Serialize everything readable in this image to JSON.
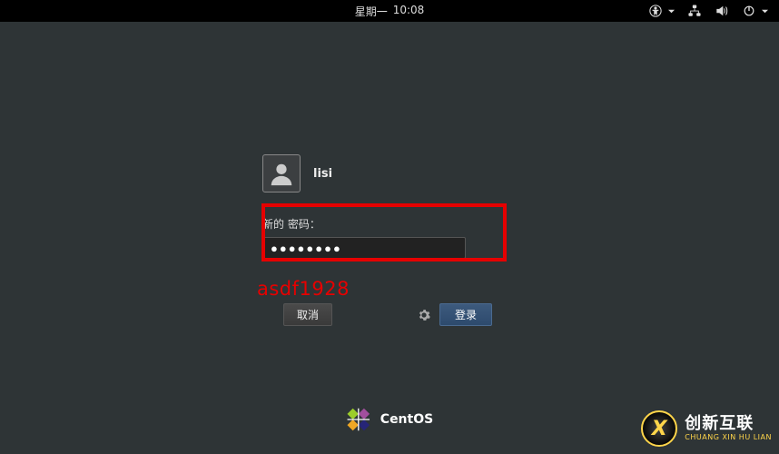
{
  "topbar": {
    "day": "星期一",
    "time": "10:08"
  },
  "login": {
    "username": "lisi",
    "password_label": "新的 密码：",
    "password_value": "●●●●●●●●"
  },
  "annotation": {
    "text": "asdf1928"
  },
  "buttons": {
    "cancel": "取消",
    "login": "登录"
  },
  "footer": {
    "brand": "CentOS"
  },
  "watermark": {
    "main": "创新互联",
    "sub": "CHUANG XIN HU LIAN"
  },
  "colors": {
    "accent_red": "#e60000",
    "brand_yellow": "#ffd54a",
    "button_primary": "#2d4a6d"
  }
}
